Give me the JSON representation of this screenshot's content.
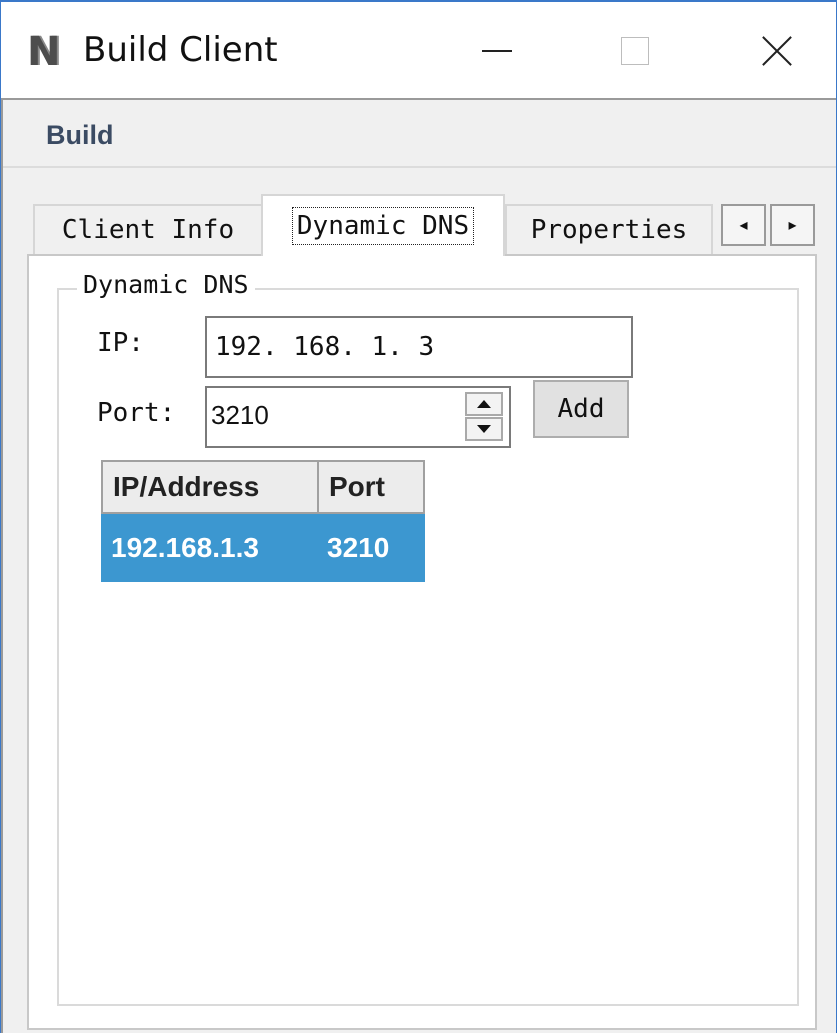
{
  "window": {
    "icon": "N",
    "title": "Build Client",
    "controls": {
      "minimize": "minimize-icon",
      "maximize": "maximize-icon",
      "close": "close-icon"
    }
  },
  "menubar": {
    "items": [
      {
        "label": "Build"
      }
    ]
  },
  "tabs": [
    {
      "label": "Client Info",
      "selected": false
    },
    {
      "label": "Dynamic DNS",
      "selected": true
    },
    {
      "label": "Properties",
      "selected": false
    }
  ],
  "tab_scroll": {
    "left": "◂",
    "right": "▸"
  },
  "dynamic_dns": {
    "group_title": "Dynamic DNS",
    "ip_label": "IP:",
    "ip_value": "192. 168. 1. 3",
    "port_label": "Port:",
    "port_value": "3210",
    "add_label": "Add",
    "list": {
      "columns": [
        "IP/Address",
        "Port"
      ],
      "rows": [
        {
          "address": "192.168.1.3",
          "port": "3210",
          "selected": true
        }
      ]
    }
  },
  "colors": {
    "accent_border": "#3a78c9",
    "selection": "#3c97d0",
    "window_bg": "#f0f0f0"
  }
}
